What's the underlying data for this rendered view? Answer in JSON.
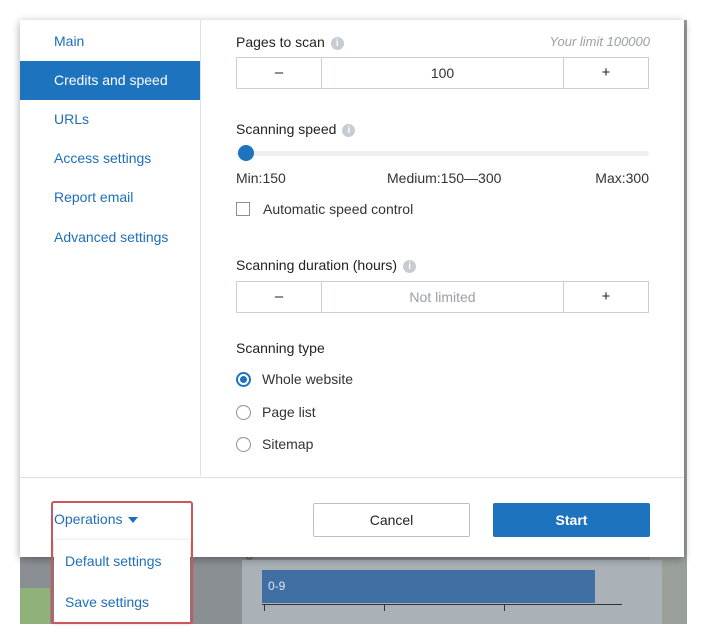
{
  "sidebar": {
    "items": [
      {
        "label": "Main",
        "active": false
      },
      {
        "label": "Credits and speed",
        "active": true
      },
      {
        "label": "URLs",
        "active": false
      },
      {
        "label": "Access settings",
        "active": false
      },
      {
        "label": "Report email",
        "active": false
      },
      {
        "label": "Advanced settings",
        "active": false
      }
    ]
  },
  "pages": {
    "label": "Pages to scan",
    "limit": "Your limit 100000",
    "minus": "–",
    "value": "100",
    "plus": "+"
  },
  "speed": {
    "label": "Scanning speed",
    "min_label": "Min:150",
    "medium_label": "Medium:150—300",
    "max_label": "Max:300",
    "slider_value_fraction": 0.0,
    "auto_label": "Automatic speed control",
    "auto_checked": false
  },
  "duration": {
    "label": "Scanning duration (hours)",
    "minus": "–",
    "placeholder": "Not limited",
    "plus": "+"
  },
  "type": {
    "label": "Scanning type",
    "options": [
      {
        "label": "Whole website",
        "checked": true
      },
      {
        "label": "Page list",
        "checked": false
      },
      {
        "label": "Sitemap",
        "checked": false
      }
    ]
  },
  "footer": {
    "operations_label": "Operations",
    "cancel_label": "Cancel",
    "start_label": "Start"
  },
  "operations_menu": {
    "items": [
      "Default settings",
      "Save settings"
    ]
  },
  "background_chart": {
    "bar_label": "0-9",
    "ylabel_fragment": "Ch"
  },
  "colors": {
    "accent": "#1e73be",
    "link": "#1f6fb8",
    "highlight": "#c9575c"
  }
}
